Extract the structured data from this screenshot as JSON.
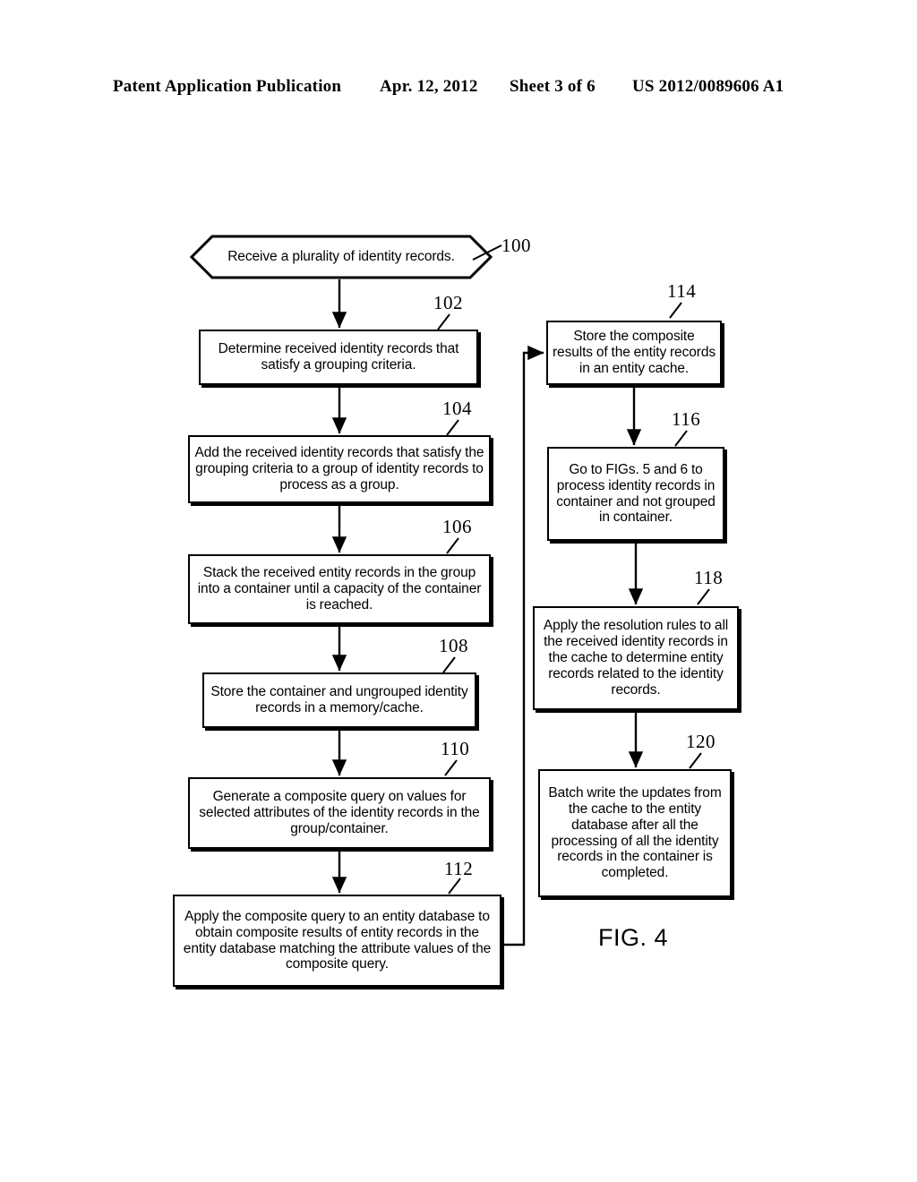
{
  "header": {
    "publication": "Patent Application Publication",
    "date": "Apr. 12, 2012",
    "sheet": "Sheet 3 of 6",
    "patent_number": "US 2012/0089606 A1"
  },
  "figure": {
    "caption": "FIG. 4",
    "nodes": [
      {
        "ref": "100",
        "shape": "terminal",
        "text": "Receive a plurality of identity records."
      },
      {
        "ref": "102",
        "shape": "process",
        "text": "Determine received identity records that satisfy a grouping criteria."
      },
      {
        "ref": "104",
        "shape": "process",
        "text": "Add the received identity records that satisfy the grouping criteria to a group of identity records to process as a group."
      },
      {
        "ref": "106",
        "shape": "process",
        "text": "Stack the received entity records in the group into a container until a capacity of the container is reached."
      },
      {
        "ref": "108",
        "shape": "process",
        "text": "Store the container and ungrouped identity records in a memory/cache."
      },
      {
        "ref": "110",
        "shape": "process",
        "text": "Generate a composite query on values for selected attributes of the identity records in the group/container."
      },
      {
        "ref": "112",
        "shape": "process",
        "text": "Apply the composite query to an entity database to obtain composite results of entity records in the entity database matching the attribute values of the composite query."
      },
      {
        "ref": "114",
        "shape": "process",
        "text": "Store the composite results of the entity records in an entity cache."
      },
      {
        "ref": "116",
        "shape": "process",
        "text": "Go to FIGs. 5 and 6 to process identity records in container and not grouped in container."
      },
      {
        "ref": "118",
        "shape": "process",
        "text": "Apply the resolution rules to all the received identity records in the cache to determine entity records related to the identity records."
      },
      {
        "ref": "120",
        "shape": "process",
        "text": "Batch write the updates from the cache to the entity database after all the processing of all the identity records in the container is completed."
      }
    ],
    "flow": [
      {
        "from": "100",
        "to": "102"
      },
      {
        "from": "102",
        "to": "104"
      },
      {
        "from": "104",
        "to": "106"
      },
      {
        "from": "106",
        "to": "108"
      },
      {
        "from": "108",
        "to": "110"
      },
      {
        "from": "110",
        "to": "112"
      },
      {
        "from": "112",
        "to": "114"
      },
      {
        "from": "114",
        "to": "116"
      },
      {
        "from": "116",
        "to": "118"
      },
      {
        "from": "118",
        "to": "120"
      }
    ]
  },
  "colors": {
    "ink": "#000000",
    "paper": "#ffffff"
  }
}
